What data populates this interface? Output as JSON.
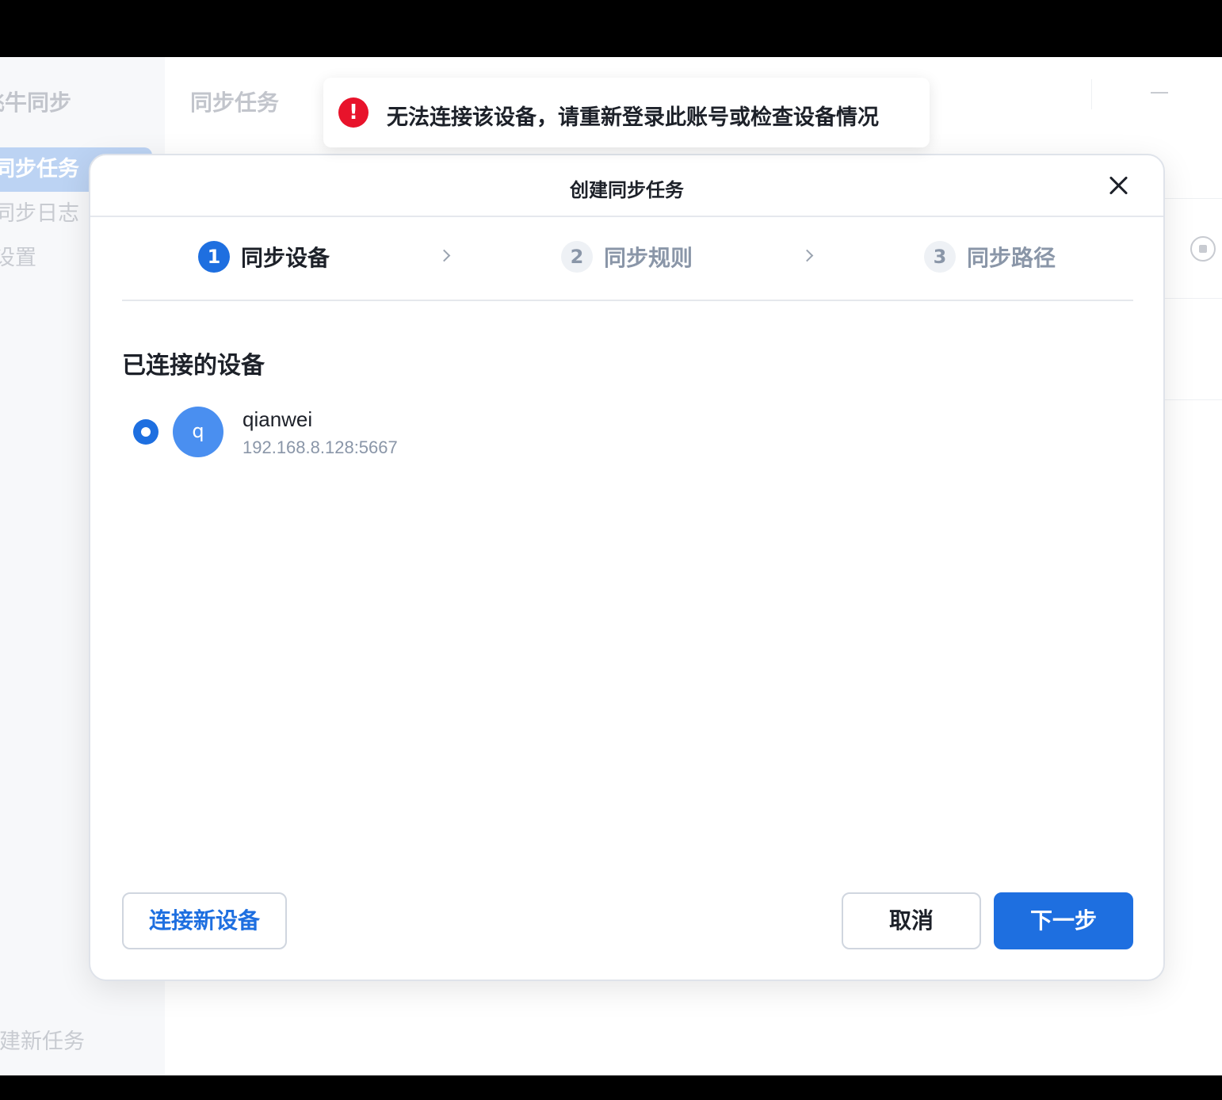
{
  "sidebar": {
    "app_title": "飞牛同步",
    "items": [
      {
        "label": "同步任务",
        "active": true
      },
      {
        "label": "同步日志",
        "active": false
      },
      {
        "label": "设置",
        "active": false
      }
    ],
    "new_task_label": "创建新任务"
  },
  "main": {
    "title": "同步任务"
  },
  "toast": {
    "icon": "error-icon",
    "icon_glyph": "!",
    "message": "无法连接该设备，请重新登录此账号或检查设备情况"
  },
  "dialog": {
    "title": "创建同步任务",
    "steps": [
      {
        "number": "1",
        "label": "同步设备",
        "state": "active"
      },
      {
        "number": "2",
        "label": "同步规则",
        "state": "inactive"
      },
      {
        "number": "3",
        "label": "同步路径",
        "state": "inactive"
      }
    ],
    "section_title": "已连接的设备",
    "devices": [
      {
        "avatar_letter": "q",
        "name": "qianwei",
        "address": "192.168.8.128:5667",
        "selected": true
      }
    ],
    "buttons": {
      "connect_new": "连接新设备",
      "cancel": "取消",
      "next": "下一步"
    }
  },
  "colors": {
    "accent": "#1e6fe0",
    "error": "#e8132b",
    "avatar": "#4a8ff0"
  }
}
